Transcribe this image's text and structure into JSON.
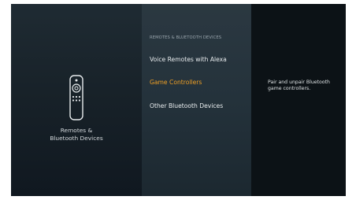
{
  "left_pane": {
    "icon": "remote-icon",
    "caption_line1": "Remotes &",
    "caption_line2": "Bluetooth Devices"
  },
  "menu": {
    "header": "REMOTES & BLUETOOTH DEVICES",
    "items": [
      {
        "label": "Voice Remotes with Alexa",
        "selected": false
      },
      {
        "label": "Game Controllers",
        "selected": true
      },
      {
        "label": "Other Bluetooth Devices",
        "selected": false
      }
    ]
  },
  "detail": {
    "description": "Pair and unpair Bluetooth game controllers."
  },
  "colors": {
    "selected_item": "#f0a024",
    "background": "#182229",
    "middle_pane": "#24323b",
    "detail_pane": "#0c1216"
  }
}
